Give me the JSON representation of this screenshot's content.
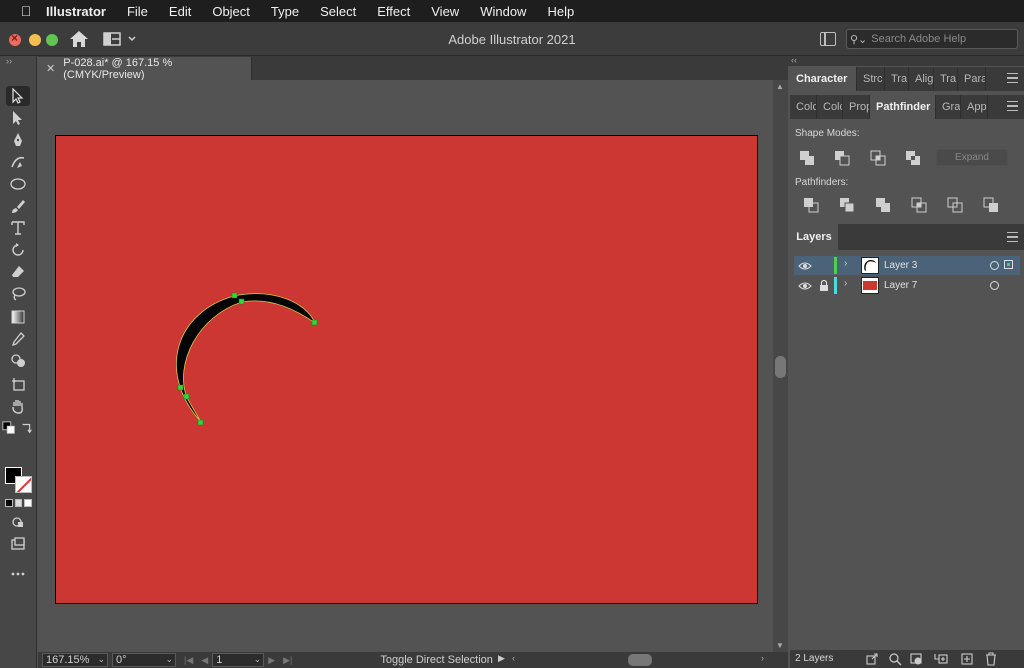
{
  "menubar": {
    "apple_icon": "apple-logo-icon",
    "app_name": "Illustrator",
    "items": [
      "File",
      "Edit",
      "Object",
      "Type",
      "Select",
      "Effect",
      "View",
      "Window",
      "Help"
    ]
  },
  "titlebar": {
    "title": "Adobe Illustrator 2021",
    "search_placeholder": "Search Adobe Help"
  },
  "document": {
    "tab_label": "P-028.ai* @ 167.15 % (CMYK/Preview)",
    "artboard_color": "#cc3633"
  },
  "statusbar": {
    "zoom": "167.15%",
    "rotation": "0°",
    "artboard_number": "1",
    "status_text": "Toggle Direct Selection"
  },
  "panels": {
    "top_tabs": [
      "Character",
      "Strc",
      "Tra",
      "Alig",
      "Tra",
      "Para"
    ],
    "second_tabs": [
      "Colc",
      "Colc",
      "Prop",
      "Pathfinder",
      "Grai",
      "App"
    ],
    "pathfinder": {
      "shape_modes_label": "Shape Modes:",
      "pathfinders_label": "Pathfinders:",
      "expand_label": "Expand"
    },
    "layers": {
      "tab_label": "Layers",
      "rows": [
        {
          "name": "Layer 3",
          "selected": true,
          "locked": false,
          "color": "#4ad24a"
        },
        {
          "name": "Layer 7",
          "selected": false,
          "locked": true,
          "color": "#4fd8e0"
        }
      ],
      "count_label": "2 Layers"
    }
  }
}
